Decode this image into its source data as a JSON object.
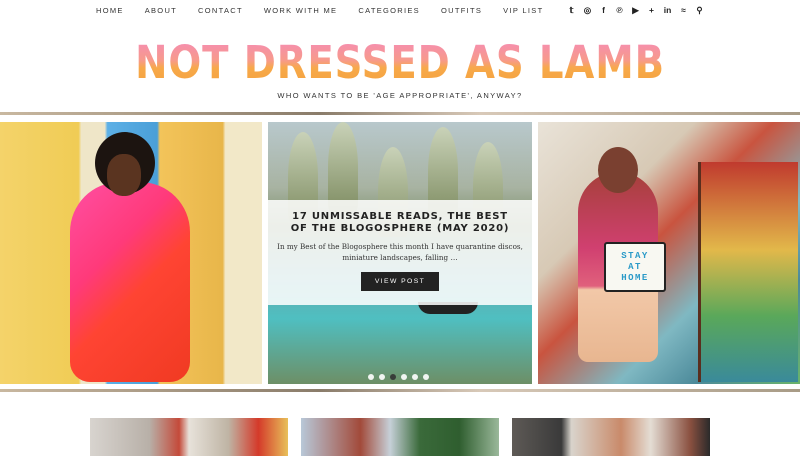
{
  "nav": {
    "links": [
      "HOME",
      "ABOUT",
      "CONTACT",
      "WORK WITH ME",
      "CATEGORIES",
      "OUTFITS",
      "VIP LIST"
    ],
    "social_icons": [
      "twitter-icon",
      "instagram-icon",
      "facebook-icon",
      "pinterest-icon",
      "youtube-icon",
      "bloglovin-icon",
      "linkedin-icon",
      "rss-icon",
      "search-icon"
    ],
    "social_glyphs": [
      "𝕥",
      "◎",
      "f",
      "℗",
      "▶",
      "+",
      "in",
      "≈",
      "⚲"
    ]
  },
  "header": {
    "logo": "NOT DRESSED AS LAMB",
    "tagline": "WHO WANTS TO BE 'AGE APPROPRIATE', ANYWAY?"
  },
  "slider": {
    "featured": {
      "title": "17 UNMISSABLE READS, THE BEST OF THE BLOGOSPHERE (MAY 2020)",
      "excerpt": "In my Best of the Blogosphere this month I have quarantine discos, miniature landscapes, falling …",
      "button": "VIEW POST"
    },
    "lightbox_words": [
      "STAY",
      "AT",
      "HOME"
    ],
    "dots_count": 6,
    "active_dot": 2
  },
  "colors": {
    "logo_top": "#f58bb8",
    "logo_bottom": "#f5a13c",
    "button_bg": "#222222"
  }
}
